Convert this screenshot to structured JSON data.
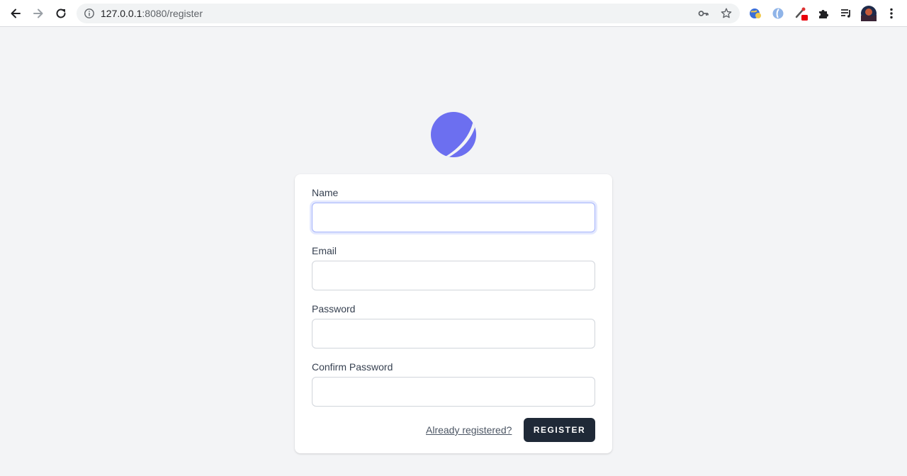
{
  "browser": {
    "url_host": "127.0.0.1",
    "url_rest": ":8080/register",
    "icons": {
      "back": "arrow-left-icon",
      "forward": "arrow-right-icon",
      "reload": "reload-icon",
      "site_info": "info-icon",
      "passwords": "key-icon",
      "bookmark": "star-icon",
      "extensions": [
        "globe-extension-icon",
        "blue-extension-icon",
        "red-badge-extension-icon",
        "puzzle-icon",
        "reading-list-icon",
        "profile-avatar",
        "more-vert-icon"
      ]
    }
  },
  "brand": {
    "accent": "#6c6ff0"
  },
  "form": {
    "name_label": "Name",
    "email_label": "Email",
    "password_label": "Password",
    "confirm_label": "Confirm Password",
    "name_value": "",
    "email_value": "",
    "password_value": "",
    "confirm_value": "",
    "already_registered_link": "Already registered?",
    "register_button": "REGISTER"
  },
  "colors": {
    "page_bg": "#f3f4f6",
    "button_bg": "#1f2937",
    "focus_ring": "#a5b4fc"
  }
}
